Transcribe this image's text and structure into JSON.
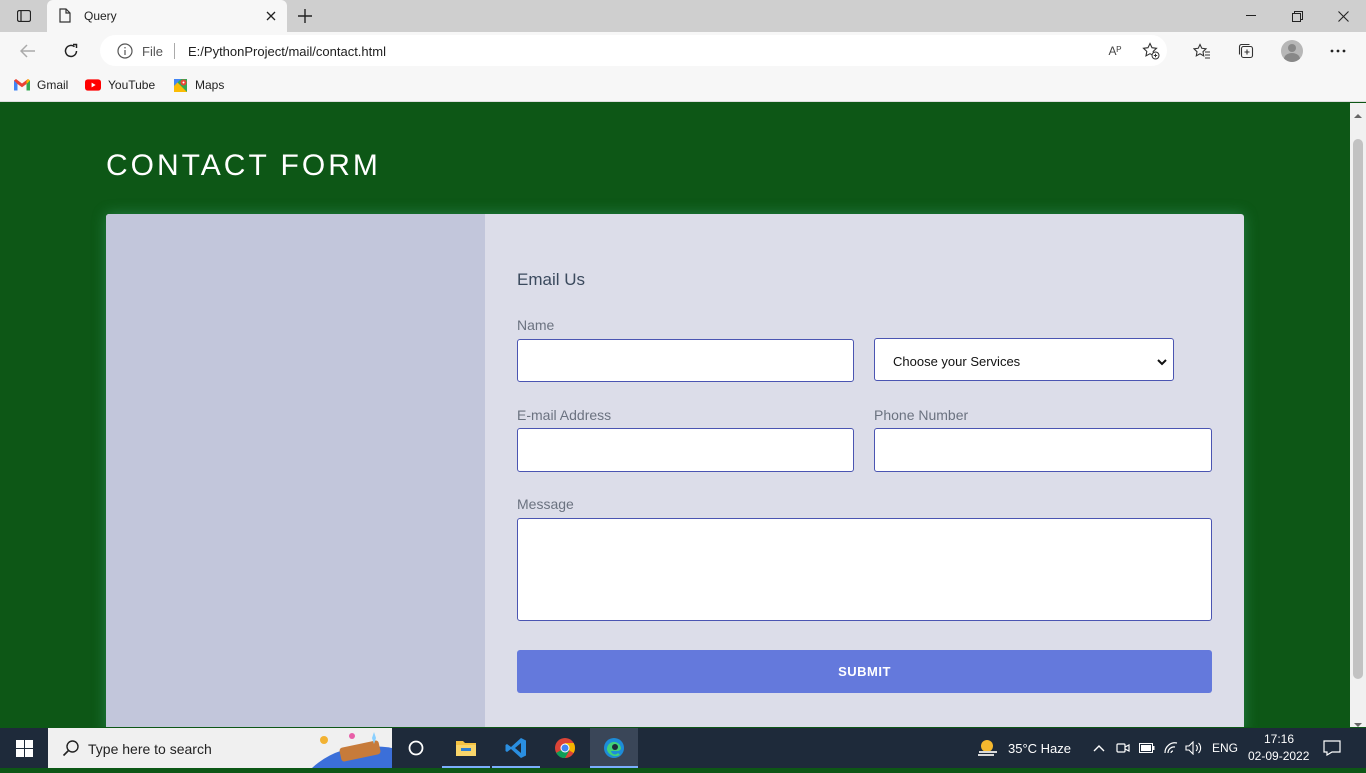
{
  "browser": {
    "tab_title": "Query",
    "address_scheme": "File",
    "address_url": "E:/PythonProject/mail/contact.html",
    "read_aloud_label": "Aᴾ",
    "bookmarks": [
      {
        "label": "Gmail",
        "icon": "gmail-icon"
      },
      {
        "label": "YouTube",
        "icon": "youtube-icon"
      },
      {
        "label": "Maps",
        "icon": "maps-icon"
      }
    ]
  },
  "page": {
    "title": "CONTACT FORM",
    "form": {
      "heading": "Email Us",
      "name_label": "Name",
      "name_value": "",
      "service_selected": "Choose your Services",
      "email_label": "E-mail Address",
      "email_value": "",
      "phone_label": "Phone Number",
      "phone_value": "",
      "message_label": "Message",
      "message_value": "",
      "submit_label": "SUBMIT"
    }
  },
  "taskbar": {
    "search_placeholder": "Type here to search",
    "weather": "35°C  Haze",
    "language": "ENG",
    "time": "17:16",
    "date": "02-09-2022"
  },
  "colors": {
    "page_background": "#0d5716",
    "card_background": "#dcdde9",
    "card_left_panel": "#c2c6db",
    "submit_button": "#6479dc",
    "input_border": "#4b55b2"
  }
}
